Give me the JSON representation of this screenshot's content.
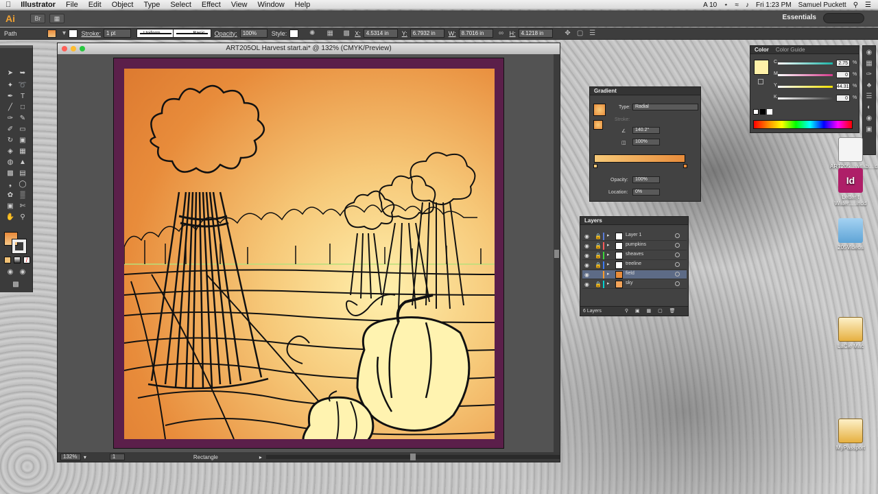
{
  "menubar": {
    "apple": "",
    "app": "Illustrator",
    "items": [
      "File",
      "Edit",
      "Object",
      "Type",
      "Select",
      "Effect",
      "View",
      "Window",
      "Help"
    ],
    "status_ai": "A 10",
    "clock": "Fri 1:23 PM",
    "user": "Samuel Puckett"
  },
  "appbar": {
    "logo": "Ai",
    "workspace": "Essentials"
  },
  "controlbar": {
    "selection_type": "Path",
    "stroke_label": "Stroke:",
    "stroke_weight": "1 pt",
    "profile": "Uniform",
    "brush": "Basic",
    "opacity_label": "Opacity:",
    "opacity": "100%",
    "style_label": "Style:",
    "x_label": "X:",
    "x": "4.5314 in",
    "y_label": "Y:",
    "y": "6.7932 in",
    "w_label": "W:",
    "w": "8.7016 in",
    "h_label": "H:",
    "h": "4.1218 in"
  },
  "document": {
    "title": "ART205OL Harvest start.ai* @ 132% (CMYK/Preview)",
    "zoom": "132%",
    "artboard": "1",
    "status": "Rectangle"
  },
  "color_panel": {
    "tab1": "Color",
    "tab2": "Color Guide",
    "channels": [
      {
        "label": "C",
        "value": "2.75",
        "color": "#19b3a6"
      },
      {
        "label": "M",
        "value": "0",
        "color": "#d43b8b"
      },
      {
        "label": "Y",
        "value": "44.31",
        "color": "#f0e000"
      },
      {
        "label": "K",
        "value": "0",
        "color": "#444444"
      }
    ],
    "pct": "%"
  },
  "gradient_panel": {
    "title": "Gradient",
    "type_label": "Type:",
    "type": "Radial",
    "stroke_label": "Stroke:",
    "angle": "140.2°",
    "aspect": "100%",
    "opacity_label": "Opacity:",
    "opacity": "100%",
    "location_label": "Location:",
    "location": "0%"
  },
  "layers_panel": {
    "title": "Layers",
    "layers": [
      {
        "name": "Layer 1",
        "color": "#5a7bd8"
      },
      {
        "name": "pumpkins",
        "color": "#ff5b5b"
      },
      {
        "name": "sheaves",
        "color": "#3ad63a"
      },
      {
        "name": "treeline",
        "color": "#3b7bff"
      },
      {
        "name": "field",
        "color": "#ff9c2a"
      },
      {
        "name": "sky",
        "color": "#00d2d2"
      }
    ],
    "count": "6 Layers"
  },
  "desktop": {
    "icons": [
      {
        "label": "ART205...syllab....d",
        "kind": "doc"
      },
      {
        "label": "Letter t Water.....indd",
        "kind": "indd",
        "badge": "Id",
        "tag": "INDD"
      },
      {
        "label": "205Videos",
        "kind": "folder"
      },
      {
        "label": "LaCie Mac",
        "kind": "drive"
      },
      {
        "label": "MyPassport",
        "kind": "drive"
      }
    ]
  }
}
